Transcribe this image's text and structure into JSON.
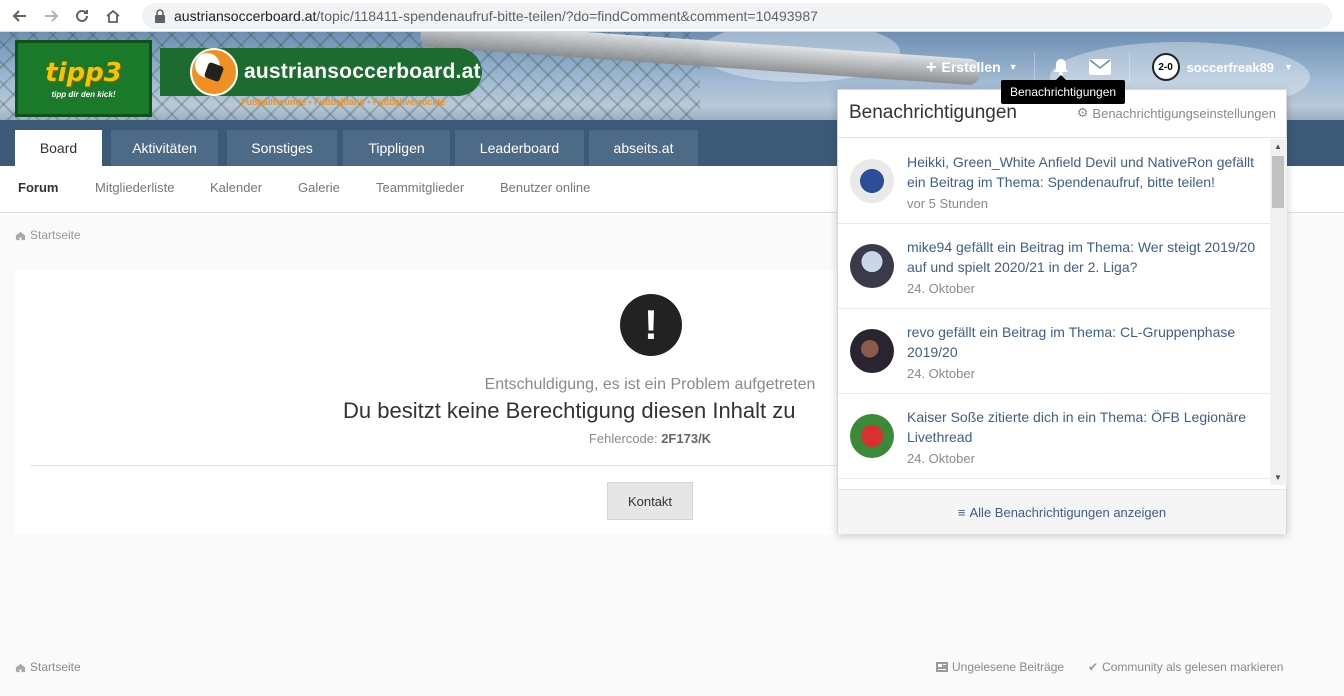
{
  "browser": {
    "url_domain": "austriansoccerboard.at",
    "url_path": "/topic/118411-spendenaufruf-bitte-teilen/?do=findComment&comment=10493987"
  },
  "header": {
    "sponsor_name": "tipp3",
    "sponsor_slogan": "tipp dir den kick!",
    "brand_name": "austriansoccerboard.at",
    "brand_subtitle": "Fußballfreunde • Fußballfans • Fußballverrückte",
    "create_label": "Erstellen",
    "username": "soccerfreak89",
    "user_avatar_text": "2-0",
    "tooltip": "Benachrichtigungen"
  },
  "tabs": [
    "Board",
    "Aktivitäten",
    "Sonstiges",
    "Tippligen",
    "Leaderboard",
    "abseits.at"
  ],
  "subnav": [
    "Forum",
    "Mitgliederliste",
    "Kalender",
    "Galerie",
    "Teammitglieder",
    "Benutzer online"
  ],
  "breadcrumb": "Startseite",
  "error": {
    "subtitle": "Entschuldigung, es ist ein Problem aufgetreten",
    "title": "Du besitzt keine Berechtigung diesen Inhalt zu",
    "code_label": "Fehlercode:",
    "code": "2F173/K",
    "contact_button": "Kontakt"
  },
  "notifications": {
    "title": "Benachrichtigungen",
    "settings_label": "Benachrichtigungseinstellungen",
    "footer_label": "Alle Benachrichtigungen anzeigen",
    "items": [
      {
        "text": "Heikki, Green_White Anfield Devil und NativeRon gefällt ein Beitrag im Thema: Spendenaufruf, bitte teilen!",
        "time": "vor 5 Stunden"
      },
      {
        "text": "mike94 gefällt ein Beitrag im Thema: Wer steigt 2019/20 auf und spielt 2020/21 in der 2. Liga?",
        "time": "24. Oktober"
      },
      {
        "text": "revo gefällt ein Beitrag im Thema: CL-Gruppenphase 2019/20",
        "time": "24. Oktober"
      },
      {
        "text": "Kaiser Soße zitierte dich in ein Thema: ÖFB Legionäre Livethread",
        "time": "24. Oktober"
      }
    ]
  },
  "footer": {
    "breadcrumb": "Startseite",
    "unread": "Ungelesene Beiträge",
    "mark_read": "Community als gelesen markieren"
  },
  "colors": {
    "header_bar": "#3c5a78",
    "link": "#3f5e8a",
    "sponsor_green": "#1a7a2a",
    "brand_orange": "#f19022"
  }
}
